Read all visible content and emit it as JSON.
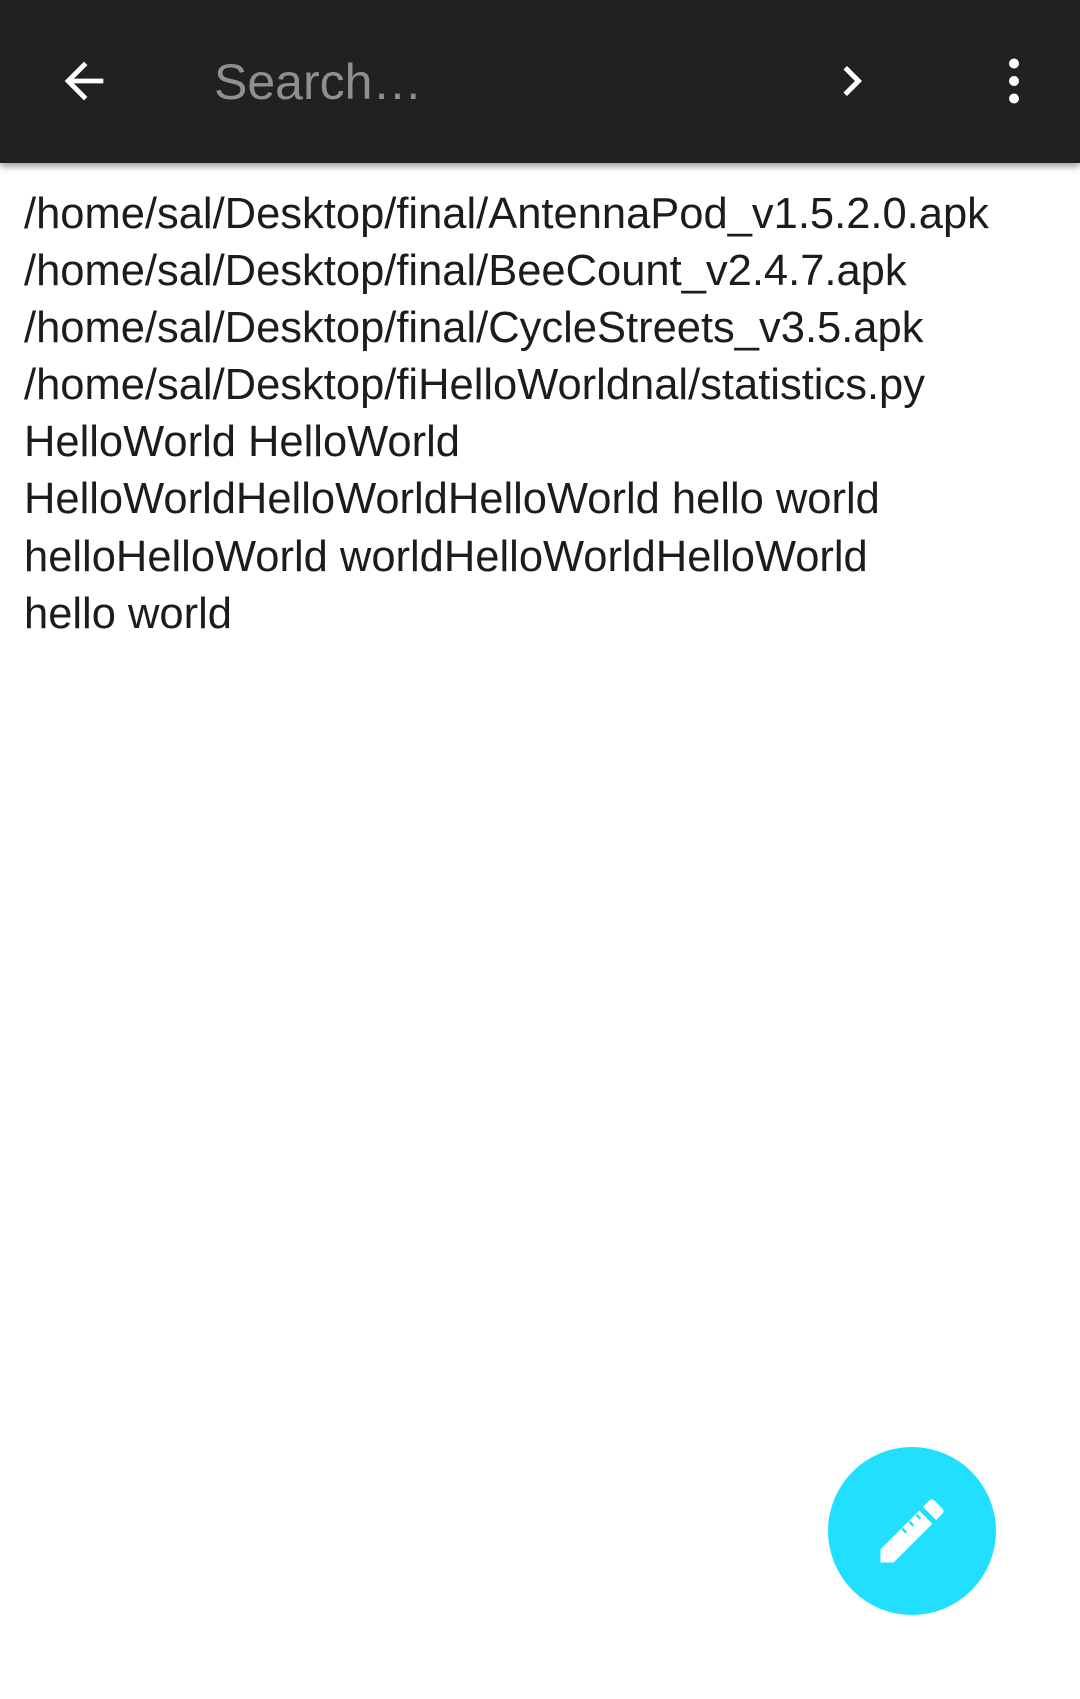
{
  "toolbar": {
    "back_icon": "arrow-back-icon",
    "search_placeholder": "Search…",
    "search_value": "",
    "next_icon": "chevron-right-icon",
    "more_icon": "more-vert-icon",
    "background_color": "#212121"
  },
  "content": {
    "text": "/home/sal/Desktop/final/AntennaPod_v1.5.2.0.apk\n/home/sal/Desktop/final/BeeCount_v2.4.7.apk\n/home/sal/Desktop/final/CycleStreets_v3.5.apk\n/home/sal/Desktop/fiHelloWorldnal/statistics.py\nHelloWorld HelloWorld\nHelloWorldHelloWorldHelloWorld hello world\nhelloHelloWorld worldHelloWorldHelloWorld\nhello world"
  },
  "fab": {
    "icon": "pencil-edit-icon",
    "color": "#21E0FF"
  }
}
